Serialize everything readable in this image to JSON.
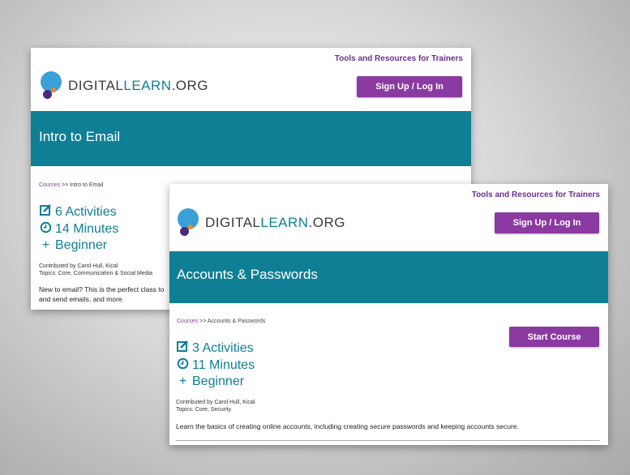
{
  "back": {
    "tools_link": "Tools and Resources for Trainers",
    "logo": {
      "part1": "DIGITAL",
      "part2": "LEARN",
      "part3": ".ORG"
    },
    "signup_label": "Sign Up / Log In",
    "banner_title": "Intro to Email",
    "breadcrumb": {
      "link": "Courses",
      "sep": " >> ",
      "current": "Intro to Email"
    },
    "activities": "6 Activities",
    "minutes": "14 Minutes",
    "level": "Beginner",
    "contributed": "Contributed by Carol Hull, Kical",
    "topics": "Topics: Core, Communication & Social Media",
    "description_line1": "New to email? This is the perfect class to",
    "description_line2": "and send emails, and more."
  },
  "front": {
    "tools_link": "Tools and Resources for Trainers",
    "logo": {
      "part1": "DIGITAL",
      "part2": "LEARN",
      "part3": ".ORG"
    },
    "signup_label": "Sign Up / Log In",
    "banner_title": "Accounts & Passwords",
    "breadcrumb": {
      "link": "Courses",
      "sep": " >> ",
      "current": "Accounts & Passwords"
    },
    "start_label": "Start Course",
    "activities": "3 Activities",
    "minutes": "11 Minutes",
    "level": "Beginner",
    "contributed": "Contributed by Carol Hull, Kical",
    "topics": "Topics: Core, Security",
    "description": "Learn the basics of creating online accounts, including creating secure passwords and keeping accounts secure."
  },
  "icons": {
    "activities": "checkbox-edit-icon",
    "minutes": "clock-icon",
    "level": "plus-icon"
  },
  "colors": {
    "brand_teal": "#0f7f95",
    "brand_purple": "#8b3aa1",
    "logo_blue": "#3aa0d8"
  }
}
